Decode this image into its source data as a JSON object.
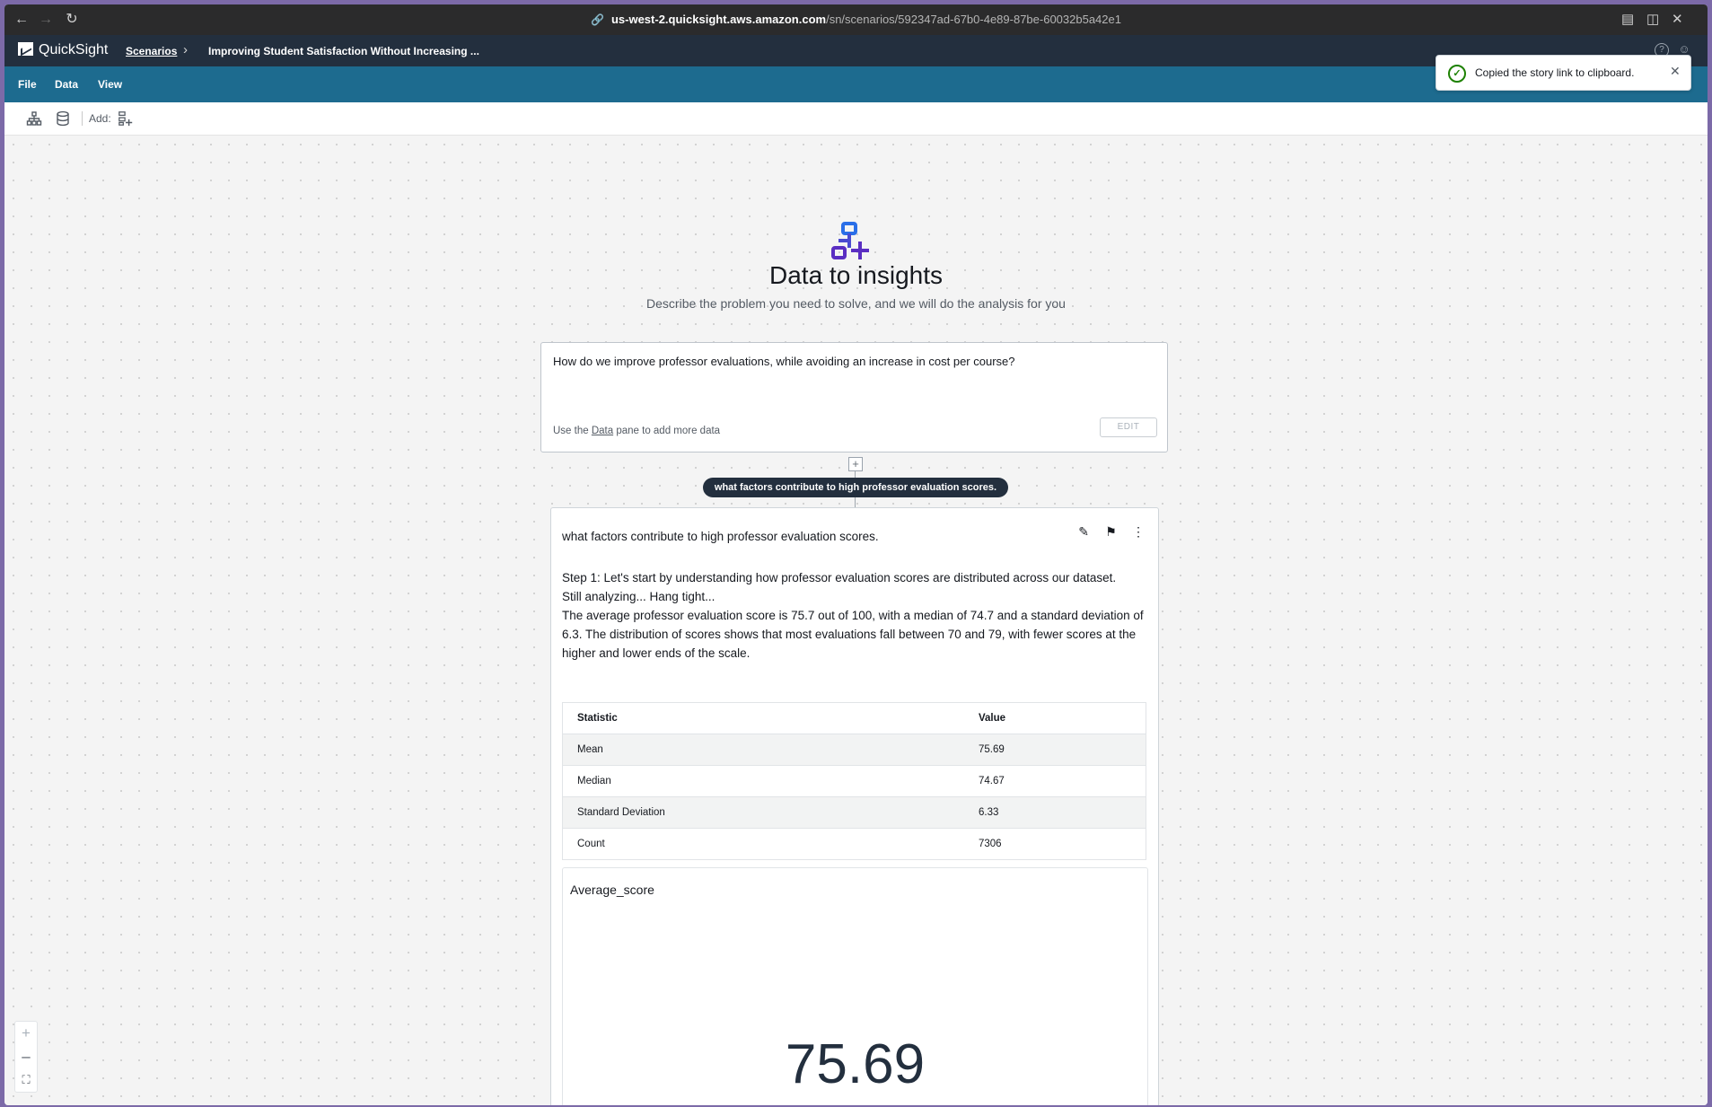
{
  "browser": {
    "url_host": "us-west-2.quicksight.aws.amazon.com",
    "url_path": "/sn/scenarios/592347ad-67b0-4e89-87be-60032b5a42e1"
  },
  "header": {
    "app_name": "QuickSight",
    "breadcrumb_root": "Scenarios",
    "breadcrumb_current": "Improving Student Satisfaction Without Increasing ..."
  },
  "menu": {
    "items": [
      "File",
      "Data",
      "View"
    ]
  },
  "toolbar": {
    "add_label": "Add:"
  },
  "toast": {
    "message": "Copied the story link to clipboard."
  },
  "hero": {
    "title": "Data to insights",
    "subtitle": "Describe the problem you need to solve, and we will do the analysis for you"
  },
  "prompt": {
    "text": "How do we improve professor evaluations, while avoiding an increase in cost per course?",
    "foot_pre": "Use the",
    "foot_link": "Data",
    "foot_post": "pane to add more data",
    "edit_label": "EDIT"
  },
  "step_pill": "what factors contribute to high professor evaluation scores.",
  "answer": {
    "title": "what factors contribute to high professor evaluation scores.",
    "paragraphs": [
      "Step 1: Let's start by understanding how professor evaluation scores are distributed across our dataset.",
      "Still analyzing... Hang tight...",
      "The average professor evaluation score is 75.7 out of 100, with a median of 74.7 and a standard deviation of 6.3. The distribution of scores shows that most evaluations fall between 70 and 79, with fewer scores at the higher and lower ends of the scale."
    ],
    "table": {
      "headers": [
        "Statistic",
        "Value"
      ],
      "rows": [
        [
          "Mean",
          "75.69"
        ],
        [
          "Median",
          "74.67"
        ],
        [
          "Standard Deviation",
          "6.33"
        ],
        [
          "Count",
          "7306"
        ]
      ]
    },
    "kpi": {
      "label": "Average_score",
      "value": "75.69"
    }
  },
  "colors": {
    "menu_bar": "#1d6b8f",
    "header": "#232f3e",
    "success": "#1d8102",
    "hero_icon_primary": "#5a2ec2",
    "hero_icon_accent": "#2a6fe8"
  }
}
